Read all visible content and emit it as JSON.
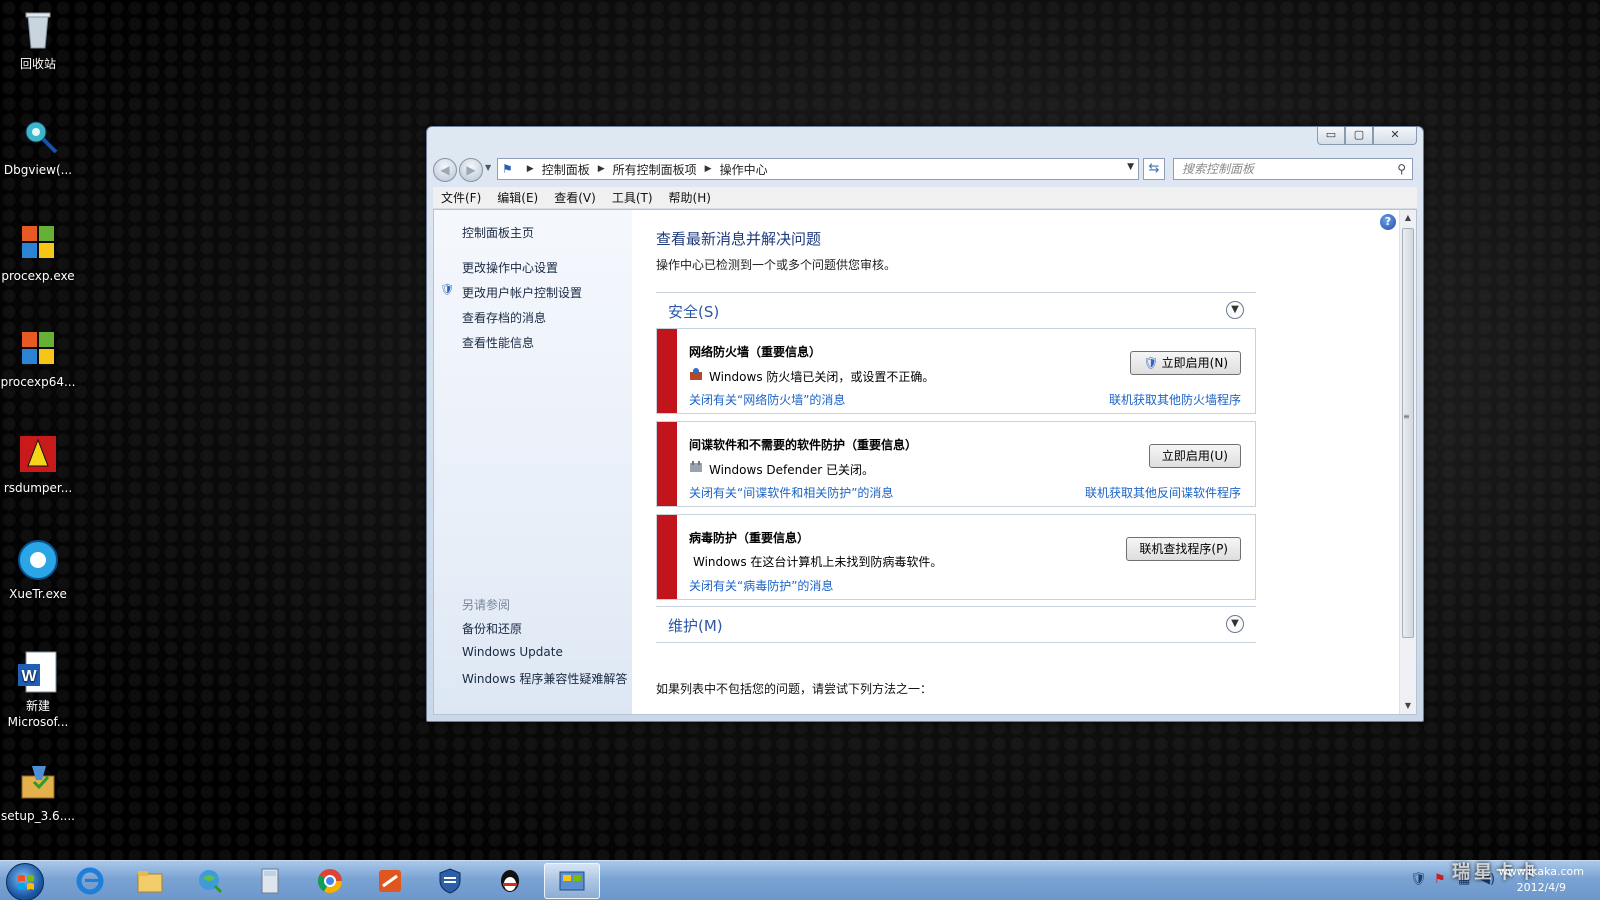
{
  "desktop": {
    "icons": [
      {
        "label": "回收站",
        "icon": "recycle-bin-icon"
      },
      {
        "label": "Dbgview(...",
        "icon": "dbgview-icon"
      },
      {
        "label": "procexp.exe",
        "icon": "procexp-icon"
      },
      {
        "label": "procexp64...",
        "icon": "procexp64-icon"
      },
      {
        "label": "rsdumper...",
        "icon": "rsdumper-icon"
      },
      {
        "label": "XueTr.exe",
        "icon": "xuetr-icon"
      },
      {
        "label": "新建 Microsof...",
        "icon": "word-doc-icon"
      },
      {
        "label": "setup_3.6....",
        "icon": "setup-icon"
      }
    ]
  },
  "window": {
    "caption": {
      "minimize": "▭",
      "maximize": "▢",
      "close": "✕"
    },
    "breadcrumb": [
      "控制面板",
      "所有控制面板项",
      "操作中心"
    ],
    "search_placeholder": "搜索控制面板",
    "menu": [
      "文件(F)",
      "编辑(E)",
      "查看(V)",
      "工具(T)",
      "帮助(H)"
    ],
    "sidebar": {
      "home": "控制面板主页",
      "links": [
        "更改操作中心设置",
        "更改用户帐户控制设置",
        "查看存档的消息",
        "查看性能信息"
      ],
      "see_also_heading": "另请参阅",
      "see_also": [
        "备份和还原",
        "Windows Update",
        "Windows 程序兼容性疑难解答"
      ]
    },
    "main": {
      "title": "查看最新消息并解决问题",
      "subtitle": "操作中心已检测到一个或多个问题供您审核。",
      "security_section": "安全(S)",
      "maintenance_section": "维护(M)",
      "alerts": [
        {
          "title": "网络防火墙（重要信息）",
          "message": "Windows 防火墙已关闭，或设置不正确。",
          "link": "关闭有关“网络防火墙”的消息",
          "link_right": "联机获取其他防火墙程序",
          "button": "立即启用(N)"
        },
        {
          "title": "间谍软件和不需要的软件防护（重要信息）",
          "message": "Windows Defender 已关闭。",
          "link": "关闭有关“间谍软件和相关防护”的消息",
          "link_right": "联机获取其他反间谍软件程序",
          "button": "立即启用(U)"
        },
        {
          "title": "病毒防护（重要信息）",
          "message": "Windows 在这台计算机上未找到防病毒软件。",
          "link": "关闭有关“病毒防护”的消息",
          "link_right": "",
          "button": "联机查找程序(P)"
        }
      ],
      "bottom_note": "如果列表中不包括您的问题，请尝试下列方法之一："
    }
  },
  "taskbar": {
    "items": [
      "ie-icon",
      "explorer-icon",
      "network-globe-icon",
      "calculator-icon",
      "chrome-icon",
      "app-orange-icon",
      "security-shield-icon",
      "qq-icon",
      "control-panel-icon"
    ],
    "watermark": "瑞星卡卡",
    "watermark_url": "www.ikaka.com",
    "date": "2012/4/9"
  },
  "colors": {
    "alert_red": "#c1141b",
    "link_blue": "#1c63c7",
    "heading_blue": "#1e3b7c"
  }
}
